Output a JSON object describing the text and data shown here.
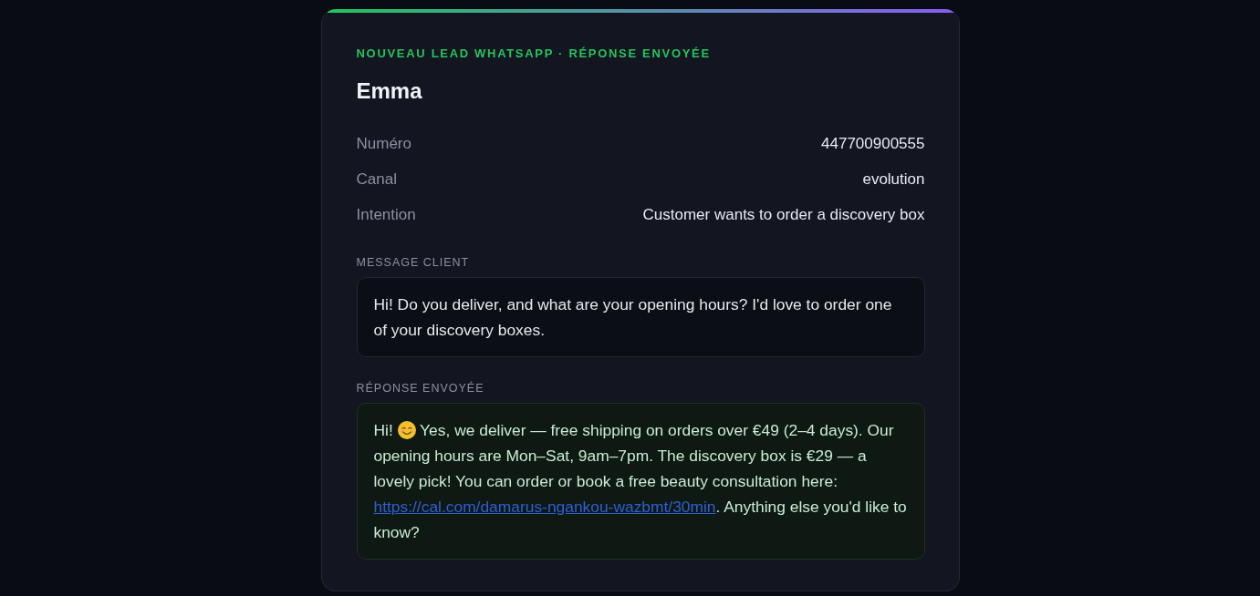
{
  "card": {
    "eyebrow": "NOUVEAU LEAD WHATSAPP · RÉPONSE ENVOYÉE",
    "name": "Emma",
    "fields": [
      {
        "label": "Numéro",
        "value": "447700900555"
      },
      {
        "label": "Canal",
        "value": "evolution"
      },
      {
        "label": "Intention",
        "value": "Customer wants to order a discovery box"
      }
    ],
    "sections": [
      {
        "kind": "client",
        "label": "MESSAGE CLIENT",
        "parts": [
          {
            "kind": "text",
            "text": "Hi! Do you deliver, and what are your opening hours? I'd love to order one of your discovery boxes."
          }
        ]
      },
      {
        "kind": "reply",
        "label": "RÉPONSE ENVOYÉE",
        "parts": [
          {
            "kind": "text",
            "text": "Hi! "
          },
          {
            "kind": "emoji"
          },
          {
            "kind": "text",
            "text": " Yes, we deliver — free shipping on orders over €49 (2–4 days). Our opening hours are Mon–Sat, 9am–7pm. The discovery box is €29 — a lovely pick! You can order or book a free beauty consultation here: "
          },
          {
            "kind": "link",
            "text": "https://cal.com/damarus-ngankou-wazbmt/30min"
          },
          {
            "kind": "text",
            "text": ". Anything else you'd like to know?"
          }
        ]
      }
    ]
  }
}
